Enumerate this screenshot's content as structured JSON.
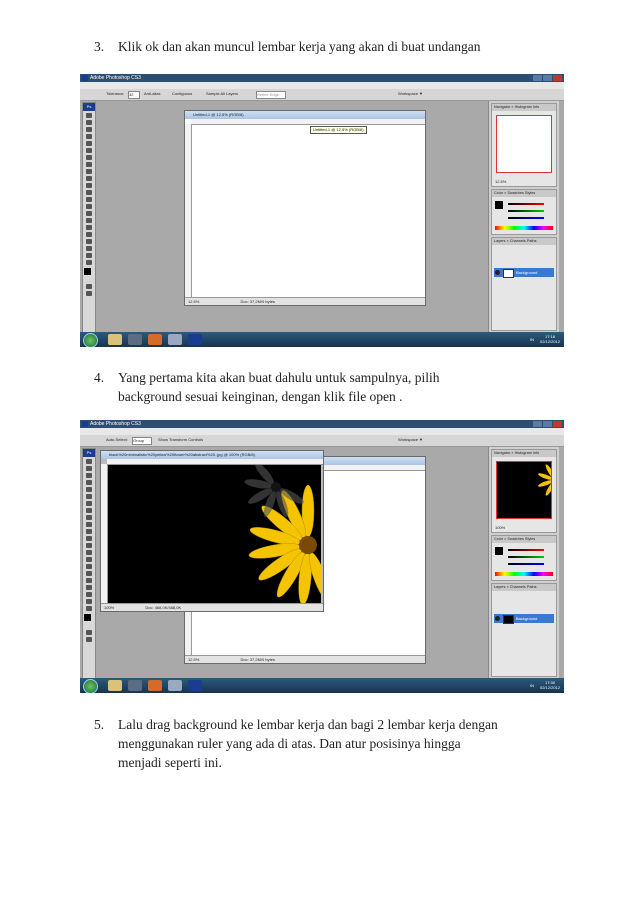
{
  "steps": [
    {
      "num": "3.",
      "lines": [
        "Klik ok dan akan muncul lembar kerja yang akan di buat undangan"
      ]
    },
    {
      "num": "4.",
      "lines": [
        "Yang pertama kita akan buat dahulu untuk sampulnya, pilih",
        "background sesuai keinginan, dengan klik file open ."
      ]
    },
    {
      "num": "5.",
      "lines": [
        "Lalu drag background ke lembar kerja dan bagi 2 lembar kerja dengan",
        "menggunakan ruler yang ada di atas. Dan atur posisinya hingga",
        "menjadi seperti ini."
      ]
    }
  ],
  "screenshot1": {
    "app_title": "Adobe Photoshop CS3",
    "menu": [
      "File",
      "Edit",
      "Image",
      "Layer",
      "Select",
      "Filter",
      "View",
      "Window",
      "Help"
    ],
    "options": {
      "tolerance_label": "Tolerance:",
      "tolerance_value": "32",
      "anti_alias": "Anti-alias",
      "contiguous": "Contiguous",
      "sample_all": "Sample All Layers",
      "refine": "Refine Edge..."
    },
    "workspace": "Workspace ▼",
    "doc_title": "Untitled-1 @ 12.5% (RGB/8)",
    "tooltip": "Untitled-1 @ 12.5% (RGB/8)",
    "zoom": "12.5%",
    "doc_size": "Doc: 37,2M/0 bytes",
    "panel_tabs": {
      "navigator": "Navigator × Histogram Info",
      "color": "Color × Swatches Styles",
      "layers": "Layers × Channels Paths"
    },
    "nav_zoom": "12.5%",
    "layer_name": "Background",
    "clock_time": "17:18",
    "clock_date": "02/12/2012",
    "tray_text": "IN"
  },
  "screenshot2": {
    "app_title": "Adobe Photoshop CS3",
    "menu": [
      "File",
      "Edit",
      "Image",
      "Layer",
      "Select",
      "Filter",
      "View",
      "Window",
      "Help"
    ],
    "options": {
      "auto_select": "Auto-Select:",
      "auto_select_value": "Group",
      "transform": "Show Transform Controls"
    },
    "workspace": "Workspace ▼",
    "doc_title": "black%20minimalistic%20yellow%20flower%20abstract%20..jpg @ 100% (RGB/8)",
    "zoom": "100%",
    "doc_size": "Doc: 468,0K/468,0K",
    "canvas_zoom": "12.5%",
    "canvas_doc_size": "Doc: 37,2M/0 bytes",
    "panel_tabs": {
      "navigator": "Navigator × Histogram Info",
      "color": "Color × Swatches Styles",
      "layers": "Layers × Channels Paths"
    },
    "nav_zoom": "100%",
    "layer_name": "Background",
    "clock_time": "17:30",
    "clock_date": "02/12/2012",
    "tray_text": "IN"
  },
  "colors": {
    "accent": "#3b78d4",
    "titlebar": "#2d4e73",
    "workspace_bg": "#a9a9a9",
    "flower": "#f5c400"
  }
}
